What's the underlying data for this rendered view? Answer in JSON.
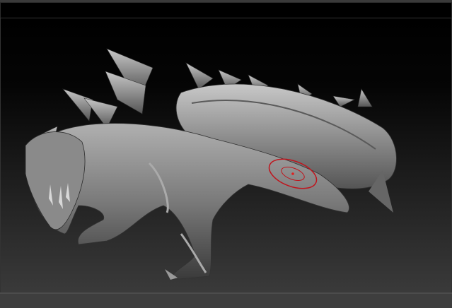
{
  "viewport": {
    "background_top": "#000000",
    "background_bottom": "#3a3a3a",
    "model_color": "#8a8a8a"
  },
  "brush_cursor": {
    "color": "#c0141c",
    "visible": true
  }
}
